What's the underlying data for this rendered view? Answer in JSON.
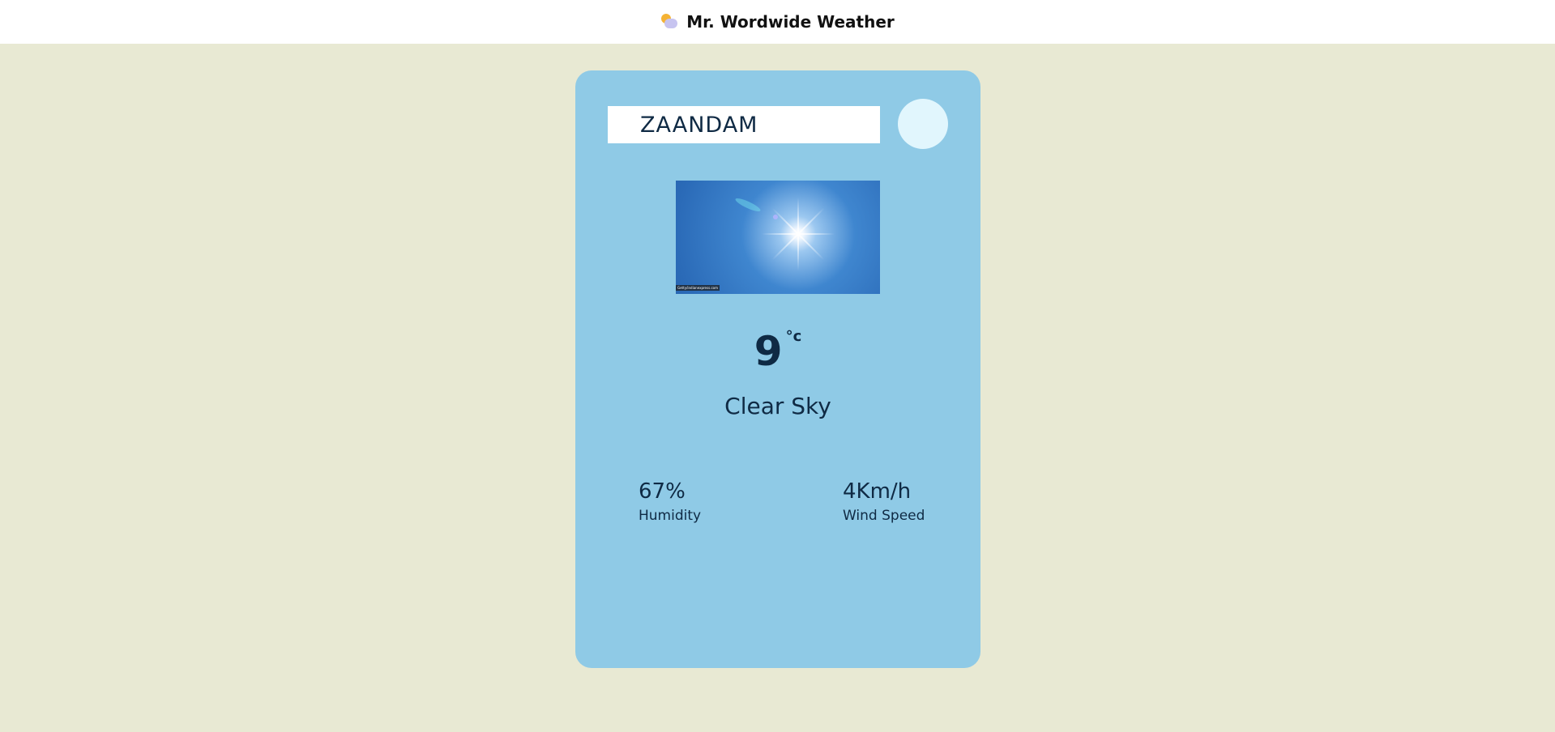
{
  "header": {
    "title": "Mr. Wordwide Weather",
    "logo_icon": "sun-behind-cloud-icon"
  },
  "search": {
    "value": "ZAANDAM",
    "button_icon": "search-button-circle"
  },
  "weather": {
    "image_credit": "Getty/indianexpress.com",
    "temperature": "9",
    "unit": "°c",
    "condition": "Clear Sky"
  },
  "stats": {
    "humidity": {
      "value": "67%",
      "label": "Humidity"
    },
    "wind": {
      "value": "4Km/h",
      "label": "Wind Speed"
    }
  },
  "colors": {
    "page_background": "#e8e9d3",
    "card_background": "#8fcae6",
    "search_button": "#e1f6fd",
    "text": "#0f2a44"
  }
}
